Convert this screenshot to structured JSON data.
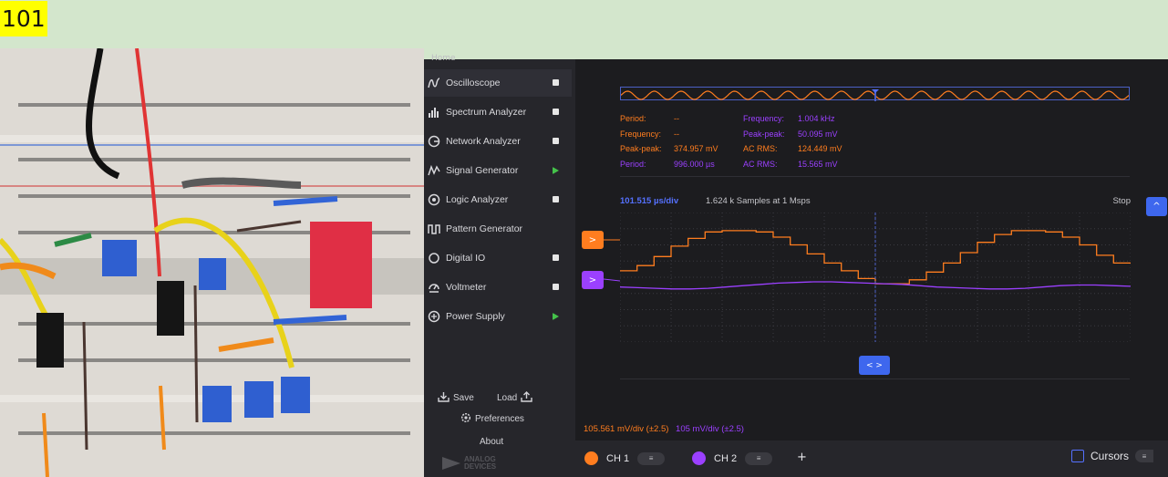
{
  "frame": {
    "label": "101"
  },
  "colors": {
    "header_bg": "#d3e6cc",
    "label_bg": "#ffff00",
    "sidebar_bg": "#26262b",
    "main_bg": "#1c1c1f",
    "ch1": "#ff7d1f",
    "ch2": "#9b40ff",
    "accent": "#3e67ee",
    "run_ok": "#44c24a"
  },
  "photo": {
    "icon": "breadboard-circuit-photo"
  },
  "sidebar": {
    "home_peek": "Home",
    "items": [
      {
        "label": "Oscilloscope",
        "icon": "oscilloscope-icon",
        "status": "stop"
      },
      {
        "label": "Spectrum Analyzer",
        "icon": "spectrum-icon",
        "status": "stop"
      },
      {
        "label": "Network Analyzer",
        "icon": "network-icon",
        "status": "stop"
      },
      {
        "label": "Signal Generator",
        "icon": "signal-generator-icon",
        "status": "play"
      },
      {
        "label": "Logic Analyzer",
        "icon": "logic-analyzer-icon",
        "status": "stop"
      },
      {
        "label": "Pattern Generator",
        "icon": "pattern-generator-icon",
        "status": "none"
      },
      {
        "label": "Digital IO",
        "icon": "digital-io-icon",
        "status": "stop"
      },
      {
        "label": "Voltmeter",
        "icon": "voltmeter-icon",
        "status": "stop"
      },
      {
        "label": "Power Supply",
        "icon": "power-supply-icon",
        "status": "play"
      }
    ],
    "save_label": "Save",
    "load_label": "Load",
    "preferences_label": "Preferences",
    "about_label": "About",
    "logo_line1": "ANALOG",
    "logo_line2": "DEVICES"
  },
  "measurements": {
    "ch1": {
      "period_label": "Period:",
      "period_value": "--",
      "frequency_label": "Frequency:",
      "frequency_value": "--",
      "peak_label": "Peak-peak:",
      "peak_value": "374.957 mV",
      "rms_label": "AC RMS:",
      "rms_value": "124.449 mV"
    },
    "ch2": {
      "frequency_label": "Frequency:",
      "frequency_value": "1.004 kHz",
      "peak_label": "Peak-peak:",
      "peak_value": "50.095 mV",
      "period_label": "Period:",
      "period_value": "996.000 µs",
      "rms_label": "AC RMS:",
      "rms_value": "15.565 mV"
    }
  },
  "plot": {
    "time_div": "101.515 µs/div",
    "samples": "1.624 k Samples at 1 Msps",
    "run_state": "Stop",
    "ch1_vdiv": "105.561 mV/div (±2.5)",
    "ch2_vdiv": "105 mV/div (±2.5)",
    "ch1_handle": ">",
    "ch2_handle": ">",
    "trigger_handle": "< >",
    "scroll_up": "^"
  },
  "bottom": {
    "ch1_label": "CH 1",
    "ch2_label": "CH 2",
    "ch_menu": "≡",
    "add_label": "+",
    "cursors_label": "Cursors",
    "cursors_menu": "≡"
  },
  "chart_data": {
    "type": "line",
    "series": [
      {
        "name": "CH 1",
        "values": [
          0.1,
          0.18,
          0.32,
          0.48,
          0.6,
          0.7,
          0.72,
          0.72,
          0.7,
          0.62,
          0.5,
          0.36,
          0.22,
          0.1,
          -0.02,
          -0.1,
          -0.1,
          -0.04,
          0.08,
          0.22,
          0.38,
          0.54,
          0.66,
          0.72,
          0.72,
          0.7,
          0.62,
          0.5,
          0.34,
          0.22
        ]
      },
      {
        "name": "CH 2",
        "values": [
          -0.15,
          -0.16,
          -0.17,
          -0.18,
          -0.18,
          -0.17,
          -0.15,
          -0.13,
          -0.11,
          -0.09,
          -0.08,
          -0.07,
          -0.07,
          -0.08,
          -0.09,
          -0.1,
          -0.11,
          -0.13,
          -0.15,
          -0.16,
          -0.17,
          -0.18,
          -0.18,
          -0.17,
          -0.15,
          -0.13,
          -0.12,
          -0.12,
          -0.13,
          -0.14
        ]
      }
    ],
    "ylim": [
      -1,
      1
    ]
  }
}
